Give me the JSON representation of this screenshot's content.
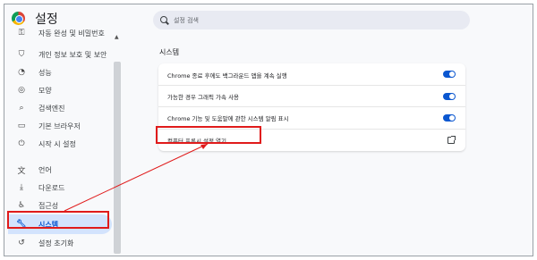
{
  "app": {
    "title": "설정"
  },
  "search": {
    "placeholder": "설정 검색"
  },
  "sidebar": {
    "items": [
      {
        "label": "자동 완성 및 비밀번호",
        "icon": "autofill-icon"
      },
      {
        "label": "개인 정보 보호 및 보안",
        "icon": "shield-icon"
      },
      {
        "label": "성능",
        "icon": "speedometer-icon"
      },
      {
        "label": "모양",
        "icon": "palette-icon"
      },
      {
        "label": "검색엔진",
        "icon": "search-icon"
      },
      {
        "label": "기본 브라우저",
        "icon": "browser-window-icon"
      },
      {
        "label": "시작 시 설정",
        "icon": "power-icon"
      },
      {
        "label": "언어",
        "icon": "translate-icon"
      },
      {
        "label": "다운로드",
        "icon": "download-icon"
      },
      {
        "label": "접근성",
        "icon": "accessibility-icon"
      },
      {
        "label": "시스템",
        "icon": "wrench-icon",
        "active": true
      },
      {
        "label": "설정 초기화",
        "icon": "reset-icon"
      }
    ]
  },
  "main": {
    "section_title": "시스템",
    "rows": [
      {
        "label": "Chrome 종료 후에도 백그라운드 앱을 계속 실행",
        "control": "toggle",
        "on": true
      },
      {
        "label": "가능한 경우 그래픽 가속 사용",
        "control": "toggle",
        "on": true
      },
      {
        "label": "Chrome 기능 및 도움말에 관한 시스템 알림 표시",
        "control": "toggle",
        "on": true
      },
      {
        "label": "컴퓨터 프록시 설정 열기",
        "control": "external-link"
      }
    ]
  },
  "colors": {
    "accent": "#0b57d0",
    "active_bg": "#d3e3fd",
    "highlight": "#e01b1b"
  }
}
